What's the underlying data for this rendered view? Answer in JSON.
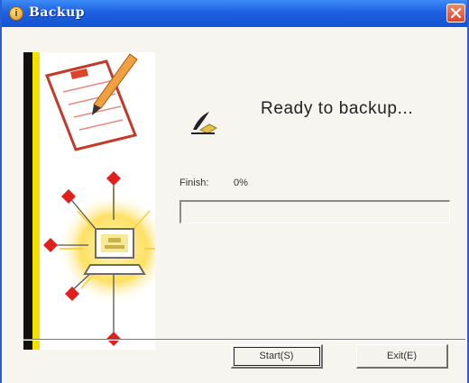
{
  "window": {
    "title": "Backup",
    "title_icon": "app-info-icon",
    "close_icon": "close-icon"
  },
  "status": {
    "icon": "feather-quill-icon",
    "message": "Ready to backup..."
  },
  "progress": {
    "label": "Finish:",
    "value_text": "0%",
    "fraction": 0
  },
  "buttons": {
    "start": "Start(S)",
    "exit": "Exit(E)"
  },
  "colors": {
    "titlebar": "#1f5fe0",
    "diamond": "#e0201c",
    "glow": "#ffd84a",
    "side_bar": "#f4e000"
  }
}
